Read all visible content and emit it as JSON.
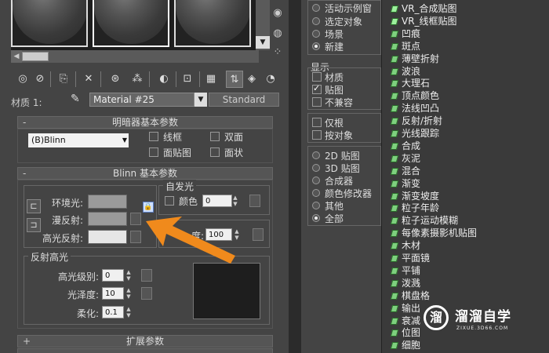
{
  "left": {
    "material_label": "材质 1:",
    "material_name": "Material #25",
    "material_type": "Standard",
    "shader_rollout": {
      "sign": "-",
      "title": "明暗器基本参数",
      "shader": "(B)Blinn",
      "options": [
        {
          "label": "线框",
          "checked": false
        },
        {
          "label": "双面",
          "checked": false
        },
        {
          "label": "面贴图",
          "checked": false
        },
        {
          "label": "面状",
          "checked": false
        }
      ]
    },
    "blinn_rollout": {
      "sign": "-",
      "title": "Blinn 基本参数",
      "ambient_label": "环境光:",
      "diffuse_label": "漫反射:",
      "specular_label": "高光反射:",
      "ambient_color": "#9a9a9a",
      "diffuse_color": "#9a9a9a",
      "specular_color": "#e6e6e6",
      "self_illum_title": "自发光",
      "color_label": "颜色",
      "self_illum_value": "0",
      "opacity_label": "度:",
      "opacity_value": "100",
      "spec_highlights_title": "反射高光",
      "spec_level_label": "高光级别:",
      "spec_level_value": "0",
      "glossiness_label": "光泽度:",
      "glossiness_value": "10",
      "soften_label": "柔化:",
      "soften_value": "0.1"
    },
    "extended_rollout": {
      "sign": "+",
      "title": "扩展参数"
    },
    "annotation_color": "#f08a1c"
  },
  "right": {
    "options_group": [
      {
        "label": "活动示例窗",
        "selected": false
      },
      {
        "label": "选定对象",
        "selected": false
      },
      {
        "label": "场景",
        "selected": false
      },
      {
        "label": "新建",
        "selected": true
      }
    ],
    "display_title": "显示",
    "display_options": [
      {
        "label": "材质",
        "checked": false
      },
      {
        "label": "贴图",
        "checked": true
      },
      {
        "label": "不兼容",
        "checked": false
      }
    ],
    "filter_options": [
      {
        "label": "仅根",
        "checked": false
      },
      {
        "label": "按对象",
        "checked": false
      }
    ],
    "category_options": [
      {
        "label": "2D 贴图",
        "selected": false
      },
      {
        "label": "3D 贴图",
        "selected": false
      },
      {
        "label": "合成器",
        "selected": false
      },
      {
        "label": "颜色修改器",
        "selected": false
      },
      {
        "label": "其他",
        "selected": false
      },
      {
        "label": "全部",
        "selected": true
      }
    ],
    "map_list": [
      "VR_合成贴图",
      "VR_线框贴图",
      "凹痕",
      "斑点",
      "薄壁折射",
      "波浪",
      "大理石",
      "顶点颜色",
      "法线凹凸",
      "反射/折射",
      "光线跟踪",
      "合成",
      "灰泥",
      "混合",
      "渐变",
      "渐变坡度",
      "粒子年龄",
      "粒子运动模糊",
      "每像素摄影机贴图",
      "木材",
      "平面镜",
      "平铺",
      "泼溅",
      "棋盘格",
      "输出",
      "衰减",
      "位图",
      "细胞"
    ]
  },
  "watermark": {
    "logo": "溜",
    "title": "溜溜自学",
    "subtitle": "ZIXUE.3D66.COM"
  }
}
